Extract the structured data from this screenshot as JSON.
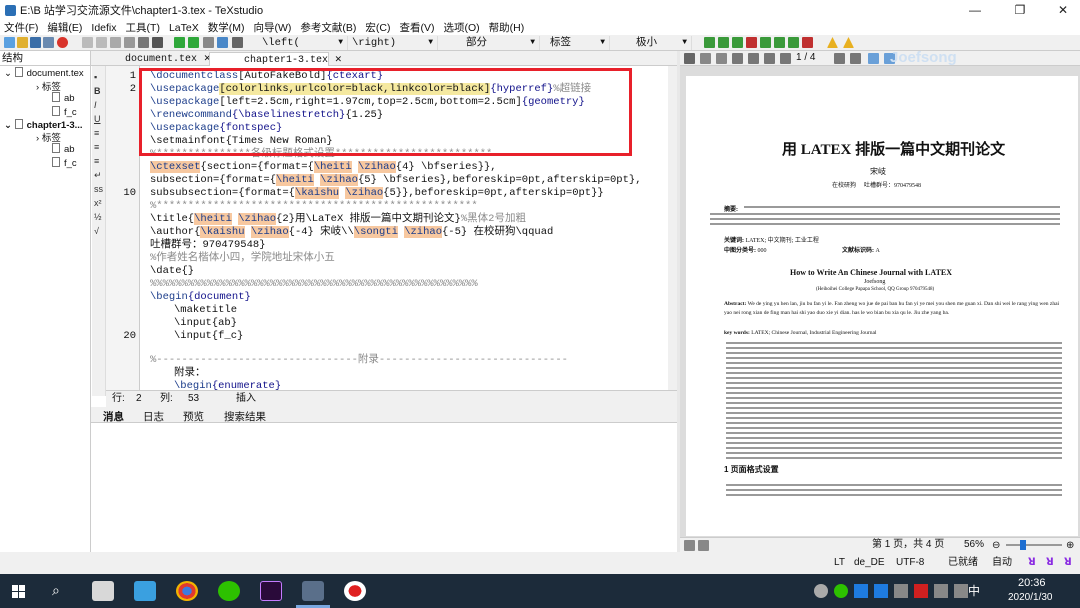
{
  "window": {
    "title": "E:\\B 站学习交流源文件\\chapter1-3.tex - TeXstudio",
    "controls": {
      "minimize": "—",
      "maximize": "❐",
      "close": "✕"
    }
  },
  "menu": [
    "文件(F)",
    "编辑(E)",
    "Idefix",
    "工具(T)",
    "LaTeX",
    "数学(M)",
    "向导(W)",
    "参考文献(B)",
    "宏(C)",
    "查看(V)",
    "选项(O)",
    "帮助(H)"
  ],
  "toolbar": {
    "left_combo": "\\left(",
    "right_combo": "\\right)",
    "part_combo": "部分",
    "label_combo": "标签",
    "size_combo": "极小"
  },
  "structure": {
    "header": "结构",
    "doc1": "document.tex",
    "label1": "标签",
    "ab1": "ab",
    "fc1": "f_c",
    "doc2": "chapter1-3...",
    "label2": "标签",
    "ab2": "ab",
    "fc2": "f_c"
  },
  "tabs": {
    "tab1": "document.tex",
    "tab2": "chapter1-3.tex",
    "close": "✕"
  },
  "gutter": {
    "n1": "1",
    "n2": "2",
    "n10": "10",
    "n20": "20"
  },
  "code": {
    "l1a": "\\documentclass",
    "l1b": "[AutoFakeBold]",
    "l1c": "{ctexart}",
    "l2a": "\\usepackage",
    "l2b": "[colorlinks,urlcolor=black,linkcolor=black]",
    "l2c": "{hyperref}",
    "l2d": "%超链接",
    "l3a": "\\usepackage",
    "l3b": "[left=2.5cm,right=1.97cm,top=2.5cm,bottom=2.5cm]",
    "l3c": "{geometry}",
    "l4a": "\\renewcommand",
    "l4b": "{\\baselinestretch}",
    "l4c": "{1.25}",
    "l5a": "\\usepackage",
    "l5b": "{fontspec}",
    "l6": "\\setmainfont{Times New Roman}",
    "l7": "%***************各级标题格式设置*************************",
    "l8a": "\\ctexset",
    "l8b": "{section={format={",
    "l8c": "\\heiti",
    "l8d": " ",
    "l8e": "\\zihao",
    "l8f": "{4} \\bfseries}},",
    "l9a": "subsection={format={",
    "l9b": "\\heiti",
    "l9c": " ",
    "l9d": "\\zihao",
    "l9e": "{5} \\bfseries},beforeskip=0pt,afterskip=0pt},",
    "l10a": "subsubsection={format={",
    "l10b": "\\kaishu",
    "l10c": " ",
    "l10d": "\\zihao",
    "l10e": "{5}},beforeskip=0pt,afterskip=0pt}}",
    "l11": "%***************************************************",
    "l12a": "\\title{",
    "l12b": "\\heiti",
    "l12c": " ",
    "l12d": "\\zihao",
    "l12e": "{2}用\\LaTeX 排版一篇中文期刊论文}",
    "l12f": "%黑体2号加粗",
    "l13a": "\\author{",
    "l13b": "\\kaishu",
    "l13c": " ",
    "l13d": "\\zihao",
    "l13e": "{-4} 宋岐\\\\",
    "l13f": "\\songti",
    "l13g": " ",
    "l13h": "\\zihao",
    "l13i": "{-5} 在校研狗\\qquad",
    "l14": "吐槽群号：970479548}",
    "l15": "%作者姓名楷体小四，学院地址宋体小五",
    "l16": "\\date{}",
    "l17": "%%%%%%%%%%%%%%%%%%%%%%%%%%%%%%%%%%%%%%%%%%%%%%%%%%%%",
    "l18a": "\\begin",
    "l18b": "{document}",
    "l19": "\\maketitle",
    "l20": "\\input{ab}",
    "l21": "\\input{f_c}",
    "l22": "%--------------------------------附录------------------------------",
    "l23": "附录：",
    "l24a": "\\begin",
    "l24b": "{enumerate}"
  },
  "status": {
    "row_label": "行:",
    "row": "2",
    "col_label": "列:",
    "col": "53",
    "mode": "插入"
  },
  "bottom_tabs": [
    "消息",
    "日志",
    "预览",
    "搜索结果"
  ],
  "preview": {
    "page_nav": "1 / 4",
    "watermark": "Joefsong",
    "title": "用 LATEX 排版一篇中文期刊论文",
    "author": "宋岐",
    "affil": "在校研狗",
    "group": "吐槽群号：970479548",
    "abstract_label": "摘要:",
    "keywords_label": "关键词:",
    "keywords": "LATEX; 中文期刊; 工业工程",
    "cls_label": "中图分类号:",
    "cls": "000",
    "code_label": "文献标识码:",
    "code": "A",
    "en_title": "How to Write An Chinese Journal with LATEX",
    "en_author": "Joefsong",
    "en_affil": "(Heihoihei College Papapa School, QQ Group 970479548)",
    "en_abs_label": "Abstract:",
    "en_abs": "We de ying yu hen lan, jiu bu fan yi le. Fan zheng wo jue de pai ban hu fan yi ye mei you shen me guan xi. Dan shi wei le rang ying wen zhai yao nei rong xian de fing man hai shi yao duo xie yi dian. has le wo bian bu xia qu le. Jiu zhe yang ba.",
    "en_kw_label": "key words:",
    "en_kw": "LATEX; Chinese Journal, Industrial Engineering Journal",
    "section": "1   页面格式设置",
    "page_status": "第 1 页，共 4 页",
    "zoom": "56%"
  },
  "texstatus": {
    "lt": "LT",
    "lang": "de_DE",
    "enc": "UTF-8",
    "ready": "已就绪",
    "auto": "自动"
  },
  "taskbar": {
    "time": "20:36",
    "date": "2020/1/30",
    "ime": "中"
  }
}
